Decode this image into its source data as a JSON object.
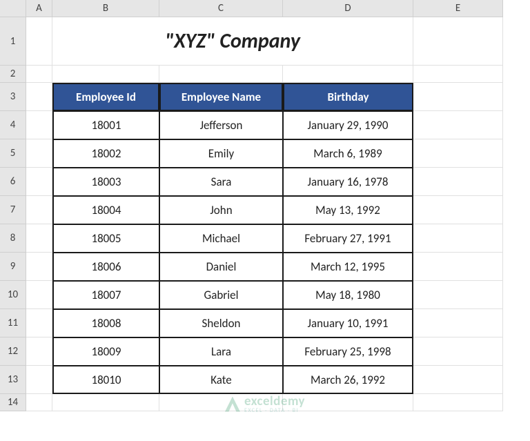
{
  "columns": [
    "A",
    "B",
    "C",
    "D",
    "E"
  ],
  "rows": [
    "1",
    "2",
    "3",
    "4",
    "5",
    "6",
    "7",
    "8",
    "9",
    "10",
    "11",
    "12",
    "13",
    "14"
  ],
  "title": "\"XYZ\" Company",
  "headers": {
    "id": "Employee Id",
    "name": "Employee Name",
    "bday": "Birthday"
  },
  "data": [
    {
      "id": "18001",
      "name": "Jefferson",
      "bday": "January 29, 1990"
    },
    {
      "id": "18002",
      "name": "Emily",
      "bday": "March 6, 1989"
    },
    {
      "id": "18003",
      "name": "Sara",
      "bday": "January 16, 1978"
    },
    {
      "id": "18004",
      "name": "John",
      "bday": "May 13, 1992"
    },
    {
      "id": "18005",
      "name": "Michael",
      "bday": "February 27, 1991"
    },
    {
      "id": "18006",
      "name": "Daniel",
      "bday": "March 12, 1995"
    },
    {
      "id": "18007",
      "name": "Gabriel",
      "bday": "May 18, 1980"
    },
    {
      "id": "18008",
      "name": "Sheldon",
      "bday": "January 10, 1991"
    },
    {
      "id": "18009",
      "name": "Lara",
      "bday": "February 25, 1998"
    },
    {
      "id": "18010",
      "name": "Kate",
      "bday": "March 26, 1992"
    }
  ],
  "watermark": {
    "main": "exceldemy",
    "sub": "EXCEL · DATA · BI"
  }
}
